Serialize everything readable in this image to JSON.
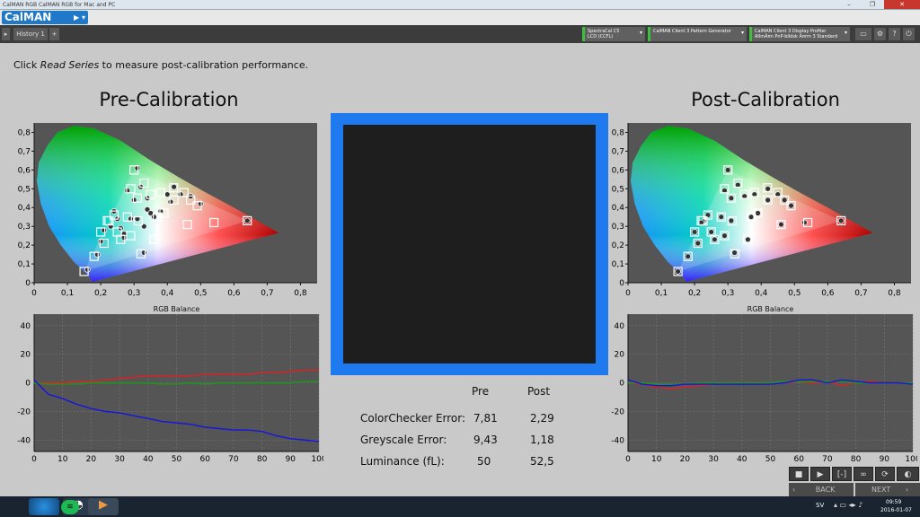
{
  "window": {
    "title": "CalMAN RGB CalMAN RGB for Mac and PC",
    "min": "–",
    "max": "❐",
    "close": "✕"
  },
  "app": {
    "logo": "CalMAN",
    "tab": "History 1",
    "tab_add": "+"
  },
  "devices": [
    {
      "line1": "SpectraCal C5",
      "line2": "LCD (CCFL)"
    },
    {
      "line1": "CalMAN Client 3 Pattern Generator",
      "line2": ""
    },
    {
      "line1": "CalMAN Client 3 Display Profiler",
      "line2": "AllmÃ¤n PnP-bildsk Ã¤rm 3 Standard"
    }
  ],
  "instruction": {
    "prefix": "Click ",
    "action": "Read Series",
    "suffix": " to measure post-calibration performance."
  },
  "pre_title": "Pre-Calibration",
  "post_title": "Post-Calibration",
  "rgb_title": "RGB Balance",
  "table": {
    "col_pre": "Pre",
    "col_post": "Post",
    "rows": [
      {
        "label": "ColorChecker Error:",
        "pre": "7,81",
        "post": "2,29"
      },
      {
        "label": "Greyscale Error:",
        "pre": "9,43",
        "post": "1,18"
      },
      {
        "label": "Luminance (fL):",
        "pre": "50",
        "post": "52,5"
      }
    ]
  },
  "nav": {
    "back": "BACK",
    "next": "NEXT"
  },
  "taskbar": {
    "lang": "SV",
    "time": "09:59",
    "date": "2016-01-07"
  },
  "chart_data": [
    {
      "type": "scatter",
      "name": "pre-cie",
      "xlim": [
        0,
        0.85
      ],
      "ylim": [
        0,
        0.85
      ],
      "xticks": [
        "0",
        "0,1",
        "0,2",
        "0,3",
        "0,4",
        "0,5",
        "0,6",
        "0,7",
        "0,8"
      ],
      "yticks": [
        "0",
        "0,1",
        "0,2",
        "0,3",
        "0,4",
        "0,5",
        "0,6",
        "0,7",
        "0,8"
      ],
      "targets": [
        [
          0.64,
          0.33
        ],
        [
          0.3,
          0.6
        ],
        [
          0.15,
          0.06
        ],
        [
          0.3127,
          0.329
        ],
        [
          0.225,
          0.329
        ],
        [
          0.321,
          0.154
        ],
        [
          0.419,
          0.505
        ],
        [
          0.24,
          0.36
        ],
        [
          0.22,
          0.33
        ],
        [
          0.25,
          0.27
        ],
        [
          0.28,
          0.35
        ],
        [
          0.21,
          0.21
        ],
        [
          0.18,
          0.14
        ],
        [
          0.26,
          0.23
        ],
        [
          0.38,
          0.48
        ],
        [
          0.33,
          0.53
        ],
        [
          0.35,
          0.47
        ],
        [
          0.42,
          0.44
        ],
        [
          0.45,
          0.48
        ],
        [
          0.47,
          0.44
        ],
        [
          0.49,
          0.41
        ],
        [
          0.54,
          0.32
        ],
        [
          0.46,
          0.31
        ],
        [
          0.39,
          0.37
        ],
        [
          0.37,
          0.35
        ],
        [
          0.31,
          0.45
        ],
        [
          0.29,
          0.5
        ],
        [
          0.36,
          0.23
        ],
        [
          0.29,
          0.25
        ],
        [
          0.2,
          0.27
        ]
      ],
      "measured": [
        [
          0.64,
          0.33
        ],
        [
          0.31,
          0.61
        ],
        [
          0.16,
          0.07
        ],
        [
          0.31,
          0.34
        ],
        [
          0.24,
          0.38
        ],
        [
          0.33,
          0.16
        ],
        [
          0.42,
          0.51
        ],
        [
          0.25,
          0.34
        ],
        [
          0.23,
          0.3
        ],
        [
          0.27,
          0.26
        ],
        [
          0.29,
          0.34
        ],
        [
          0.2,
          0.22
        ],
        [
          0.19,
          0.15
        ],
        [
          0.27,
          0.24
        ],
        [
          0.4,
          0.47
        ],
        [
          0.32,
          0.51
        ],
        [
          0.34,
          0.45
        ],
        [
          0.41,
          0.43
        ],
        [
          0.44,
          0.47
        ],
        [
          0.47,
          0.46
        ],
        [
          0.5,
          0.42
        ],
        [
          0.34,
          0.39
        ],
        [
          0.35,
          0.37
        ],
        [
          0.38,
          0.38
        ],
        [
          0.36,
          0.35
        ],
        [
          0.3,
          0.44
        ],
        [
          0.28,
          0.49
        ],
        [
          0.33,
          0.3
        ],
        [
          0.26,
          0.29
        ],
        [
          0.21,
          0.28
        ]
      ]
    },
    {
      "type": "line",
      "name": "pre-rgb-balance",
      "title": "RGB Balance",
      "x": [
        0,
        5,
        10,
        15,
        20,
        25,
        30,
        35,
        40,
        45,
        50,
        55,
        60,
        65,
        70,
        75,
        80,
        85,
        90,
        95,
        100
      ],
      "xticks": [
        "0",
        "10",
        "20",
        "30",
        "40",
        "50",
        "60",
        "70",
        "80",
        "90",
        "100"
      ],
      "yticks": [
        "-40",
        "-20",
        "0",
        "20",
        "40"
      ],
      "xlim": [
        0,
        100
      ],
      "ylim": [
        -48,
        48
      ],
      "series": [
        {
          "color": "#e02020",
          "values": [
            0,
            0,
            0,
            1,
            1,
            2,
            3,
            4,
            5,
            5,
            5,
            5,
            6,
            6,
            6,
            6,
            7,
            7,
            8,
            9,
            9
          ]
        },
        {
          "color": "#1a9a1a",
          "values": [
            0,
            -1,
            -1,
            -1,
            0,
            0,
            0,
            0,
            0,
            -1,
            -1,
            0,
            -1,
            0,
            0,
            0,
            0,
            0,
            0,
            1,
            1
          ]
        },
        {
          "color": "#1515e0",
          "values": [
            2,
            -8,
            -11,
            -15,
            -18,
            -20,
            -21,
            -23,
            -25,
            -27,
            -28,
            -29,
            -31,
            -32,
            -33,
            -33,
            -34,
            -37,
            -39,
            -40,
            -41
          ]
        }
      ]
    },
    {
      "type": "scatter",
      "name": "post-cie",
      "xlim": [
        0,
        0.85
      ],
      "ylim": [
        0,
        0.85
      ],
      "xticks": [
        "0",
        "0,1",
        "0,2",
        "0,3",
        "0,4",
        "0,5",
        "0,6",
        "0,7",
        "0,8"
      ],
      "yticks": [
        "0",
        "0,1",
        "0,2",
        "0,3",
        "0,4",
        "0,5",
        "0,6",
        "0,7",
        "0,8"
      ],
      "targets": [
        [
          0.64,
          0.33
        ],
        [
          0.3,
          0.6
        ],
        [
          0.15,
          0.06
        ],
        [
          0.3127,
          0.329
        ],
        [
          0.225,
          0.329
        ],
        [
          0.321,
          0.154
        ],
        [
          0.419,
          0.505
        ],
        [
          0.24,
          0.36
        ],
        [
          0.22,
          0.33
        ],
        [
          0.25,
          0.27
        ],
        [
          0.28,
          0.35
        ],
        [
          0.21,
          0.21
        ],
        [
          0.18,
          0.14
        ],
        [
          0.26,
          0.23
        ],
        [
          0.38,
          0.48
        ],
        [
          0.33,
          0.53
        ],
        [
          0.35,
          0.47
        ],
        [
          0.42,
          0.44
        ],
        [
          0.45,
          0.48
        ],
        [
          0.47,
          0.44
        ],
        [
          0.49,
          0.41
        ],
        [
          0.54,
          0.32
        ],
        [
          0.46,
          0.31
        ],
        [
          0.39,
          0.37
        ],
        [
          0.37,
          0.35
        ],
        [
          0.31,
          0.45
        ],
        [
          0.29,
          0.5
        ],
        [
          0.36,
          0.23
        ],
        [
          0.29,
          0.25
        ],
        [
          0.2,
          0.27
        ]
      ],
      "measured": [
        [
          0.64,
          0.33
        ],
        [
          0.3,
          0.6
        ],
        [
          0.15,
          0.06
        ],
        [
          0.31,
          0.33
        ],
        [
          0.23,
          0.33
        ],
        [
          0.32,
          0.16
        ],
        [
          0.42,
          0.5
        ],
        [
          0.24,
          0.36
        ],
        [
          0.22,
          0.32
        ],
        [
          0.25,
          0.27
        ],
        [
          0.28,
          0.35
        ],
        [
          0.21,
          0.21
        ],
        [
          0.18,
          0.14
        ],
        [
          0.26,
          0.23
        ],
        [
          0.38,
          0.47
        ],
        [
          0.33,
          0.52
        ],
        [
          0.35,
          0.46
        ],
        [
          0.42,
          0.44
        ],
        [
          0.45,
          0.47
        ],
        [
          0.47,
          0.44
        ],
        [
          0.49,
          0.41
        ],
        [
          0.53,
          0.32
        ],
        [
          0.46,
          0.31
        ],
        [
          0.39,
          0.37
        ],
        [
          0.37,
          0.35
        ],
        [
          0.31,
          0.45
        ],
        [
          0.29,
          0.49
        ],
        [
          0.36,
          0.23
        ],
        [
          0.29,
          0.25
        ],
        [
          0.2,
          0.27
        ]
      ]
    },
    {
      "type": "line",
      "name": "post-rgb-balance",
      "title": "RGB Balance",
      "x": [
        0,
        5,
        10,
        15,
        20,
        25,
        30,
        35,
        40,
        45,
        50,
        55,
        60,
        65,
        70,
        75,
        80,
        85,
        90,
        95,
        100
      ],
      "xticks": [
        "0",
        "10",
        "20",
        "30",
        "40",
        "50",
        "60",
        "70",
        "80",
        "90",
        "100"
      ],
      "yticks": [
        "-40",
        "-20",
        "0",
        "20",
        "40"
      ],
      "xlim": [
        0,
        100
      ],
      "ylim": [
        -48,
        48
      ],
      "series": [
        {
          "color": "#e02020",
          "values": [
            0,
            -1,
            -3,
            -4,
            -3,
            -2,
            -1,
            0,
            0,
            0,
            -1,
            0,
            1,
            0,
            1,
            -2,
            0,
            1,
            0,
            0,
            0
          ]
        },
        {
          "color": "#1a9a1a",
          "values": [
            0,
            0,
            -1,
            -1,
            -1,
            0,
            0,
            0,
            0,
            0,
            0,
            1,
            1,
            1,
            1,
            1,
            0,
            0,
            0,
            0,
            0
          ]
        },
        {
          "color": "#1515e0",
          "values": [
            2,
            -1,
            -2,
            -2,
            -1,
            -1,
            -1,
            -1,
            -1,
            -1,
            -1,
            0,
            2,
            2,
            0,
            2,
            1,
            0,
            0,
            0,
            -1
          ]
        }
      ]
    }
  ]
}
